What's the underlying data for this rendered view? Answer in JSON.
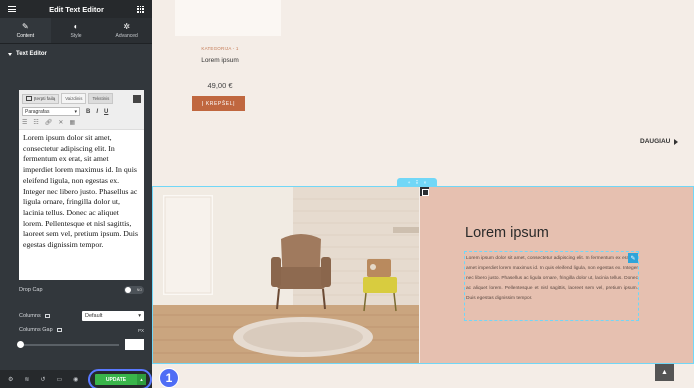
{
  "panel": {
    "title": "Edit Text Editor",
    "tabs": [
      {
        "label": "Content",
        "glyph": "✎"
      },
      {
        "label": "Style",
        "glyph": "◐"
      },
      {
        "label": "Advanced",
        "glyph": "✲"
      }
    ],
    "section_title": "Text Editor",
    "toolbar": {
      "add_media": "Įterpti failą",
      "visual_tab": "Vaizdinis",
      "text_tab": "Tekstinis",
      "paragraph": "Paragrafas",
      "bold": "B",
      "italic": "I",
      "underline": "U"
    },
    "editor_text": "Lorem ipsum dolor sit amet, consectetur adipiscing elit. In fermentum ex erat, sit amet imperdiet lorem maximus id. In quis eleifend ligula, non egestas ex. Integer nec libero justo. Phasellus ac ligula ornare, fringilla dolor ut, lacinia tellus. Donec ac aliquet lorem. Pellentesque et nisl sagittis, laoreet sem vel, pretium ipsum. Duis egestas dignissim tempor.",
    "drop_cap_label": "Drop Cap",
    "drop_cap_toggle": "NO",
    "columns_label": "Columns",
    "columns_value": "Default",
    "columns_gap_label": "Columns Gap",
    "columns_gap_unit": "PX",
    "update_label": "UPDATE",
    "callout_number": "1"
  },
  "canvas": {
    "category": "KATEGORIJA - 1",
    "product_title": "Lorem ipsum",
    "price": "49,00 €",
    "cart_button": "Į KREPŠELĮ",
    "more_link": "DAUGIAU",
    "heading": "Lorem ipsum",
    "body_text": "Lorem ipsum dolor sit amet, consectetur adipiscing elit. In fermentum ex erat, sit amet imperdiet lorem maximus id. In quis eleifend ligula, non egestas ex. Integer nec libero justo. Phasellus ac ligula ornare, fringilla dolor ut, lacinia tellus. Donec ac aliquet lorem. Pellentesque et nisl sagittis, laoreet sem vel, pretium ipsum. Duis egestas dignissim tempor."
  },
  "colors": {
    "panel_bg": "#32373c",
    "accent_blue": "#71d7f7",
    "update_green": "#39b54a",
    "cart_brown": "#c0673f",
    "column_pink": "#e6c0b0"
  }
}
